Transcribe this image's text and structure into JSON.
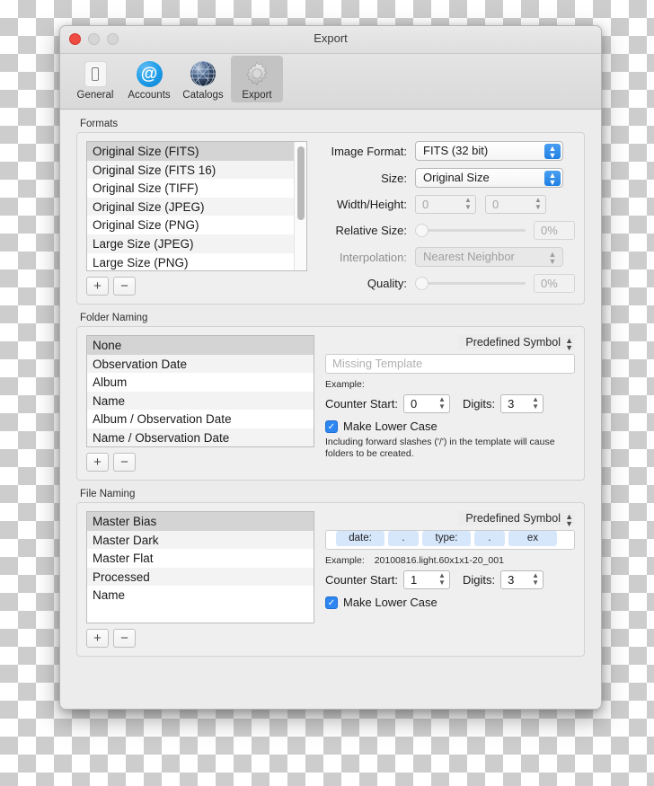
{
  "window": {
    "title": "Export"
  },
  "toolbar": {
    "items": [
      {
        "label": "General",
        "icon": "device-icon",
        "selected": false
      },
      {
        "label": "Accounts",
        "icon": "at-sign-icon",
        "selected": false
      },
      {
        "label": "Catalogs",
        "icon": "globe-icon",
        "selected": false
      },
      {
        "label": "Export",
        "icon": "gear-icon",
        "selected": true
      }
    ]
  },
  "formats": {
    "title": "Formats",
    "items": [
      "Original Size (FITS)",
      "Original Size (FITS 16)",
      "Original Size (TIFF)",
      "Original Size (JPEG)",
      "Original Size (PNG)",
      "Large Size (JPEG)",
      "Large Size (PNG)"
    ],
    "selected_index": 0,
    "add_label": "+",
    "remove_label": "−",
    "fields": {
      "image_format_label": "Image Format:",
      "image_format_value": "FITS (32 bit)",
      "size_label": "Size:",
      "size_value": "Original Size",
      "width_height_label": "Width/Height:",
      "width_value": "0",
      "height_value": "0",
      "relative_size_label": "Relative Size:",
      "relative_size_value": "0%",
      "interpolation_label": "Interpolation:",
      "interpolation_value": "Nearest Neighbor",
      "quality_label": "Quality:",
      "quality_value": "0%"
    }
  },
  "folder_naming": {
    "title": "Folder Naming",
    "items": [
      "None",
      "Observation Date",
      "Album",
      "Name",
      "Album / Observation Date",
      "Name / Observation Date"
    ],
    "selected_index": 0,
    "add_label": "+",
    "remove_label": "−",
    "symbol_popup": "Predefined Symbol",
    "template_placeholder": "Missing Template",
    "example_label": "Example:",
    "example_value": "",
    "counter_start_label": "Counter Start:",
    "counter_start_value": "0",
    "digits_label": "Digits:",
    "digits_value": "3",
    "lower_case_label": "Make Lower Case",
    "lower_case_checked": true,
    "note": "Including forward slashes ('/') in the template will cause folders to be created."
  },
  "file_naming": {
    "title": "File Naming",
    "items": [
      "Master Bias",
      "Master Dark",
      "Master Flat",
      "Processed",
      "Name"
    ],
    "selected_index": 0,
    "add_label": "+",
    "remove_label": "−",
    "symbol_popup": "Predefined Symbol",
    "tokens": [
      "date:",
      ".",
      "type:",
      ".",
      "ex"
    ],
    "example_label": "Example:",
    "example_value": "20100816.light.60x1x1-20_001",
    "counter_start_label": "Counter Start:",
    "counter_start_value": "1",
    "digits_label": "Digits:",
    "digits_value": "3",
    "lower_case_label": "Make Lower Case",
    "lower_case_checked": true
  },
  "colors": {
    "accent_blue": "#2e86f0",
    "close_red": "#ee4b42",
    "token_blue": "#d6e7fb",
    "selection_gray": "#d4d4d4"
  }
}
